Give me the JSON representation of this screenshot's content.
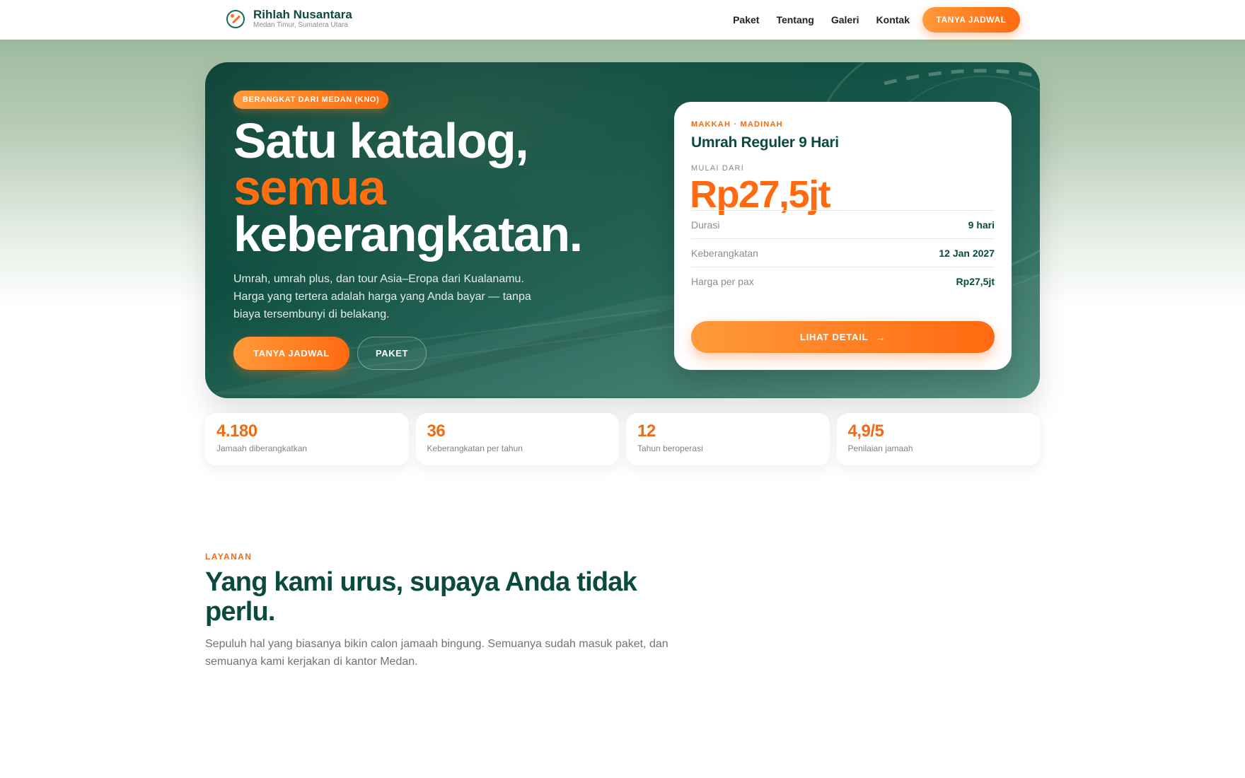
{
  "nav": {
    "brand_name": "Rihlah Nusantara",
    "brand_sub": "Medan Timur, Sumatera Utara",
    "links": [
      "Paket",
      "Tentang",
      "Galeri",
      "Kontak"
    ],
    "cta": "TANYA JADWAL"
  },
  "hero": {
    "badge": "BERANGKAT DARI MEDAN (KNO)",
    "title_line1": "Satu katalog,",
    "title_accent": "semua",
    "title_line3": "keberangkatan.",
    "description": "Umrah, umrah plus, dan tour Asia–Eropa dari Kualanamu. Harga yang tertera adalah harga yang Anda bayar — tanpa biaya tersembunyi di belakang.",
    "btn_primary": "TANYA JADWAL",
    "btn_secondary": "PAKET"
  },
  "package": {
    "destination": "MAKKAH · MADINAH",
    "title": "Umrah Reguler 9 Hari",
    "from_label": "MULAI DARI",
    "price": "Rp27,5jt",
    "rows": [
      {
        "key": "Durasi",
        "value": "9 hari"
      },
      {
        "key": "Keberangkatan",
        "value": "12 Jan 2027"
      },
      {
        "key": "Harga per pax",
        "value": "Rp27,5jt"
      }
    ],
    "detail_btn": "LIHAT DETAIL",
    "arrow": "→"
  },
  "stats": [
    {
      "value": "4.180",
      "label": "Jamaah diberangkatkan"
    },
    {
      "value": "36",
      "label": "Keberangkatan per tahun"
    },
    {
      "value": "12",
      "label": "Tahun beroperasi"
    },
    {
      "value": "4,9/5",
      "label": "Penilaian jamaah"
    }
  ],
  "services": {
    "eyebrow": "LAYANAN",
    "title": "Yang kami urus, supaya Anda tidak perlu.",
    "description": "Sepuluh hal yang biasanya bikin calon jamaah bingung. Semuanya sudah masuk paket, dan semuanya kami kerjakan di kantor Medan."
  },
  "colors": {
    "accent": "#ff6a10",
    "brand_green": "#0b4a3f"
  }
}
